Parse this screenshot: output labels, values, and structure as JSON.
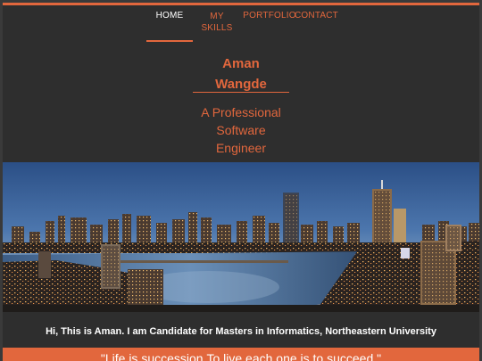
{
  "nav": {
    "home": "HOME",
    "skills_line1": "MY",
    "skills_line2": "SKILLS",
    "portfolio": "PORTFOLIO",
    "contact": "CONTACT"
  },
  "profile": {
    "first_name": "Aman",
    "last_name": "Wangde",
    "tagline_1": "A Professional",
    "tagline_2": "Software",
    "tagline_3": "Engineer"
  },
  "intro": "Hi, This is Aman. I am Candidate for Masters in Informatics, Northeastern University",
  "quote": "\"Life is succession.To live each one is to succeed.\"",
  "colors": {
    "accent": "#e2673d",
    "background": "#2e2e2e",
    "text": "#ffffff"
  }
}
